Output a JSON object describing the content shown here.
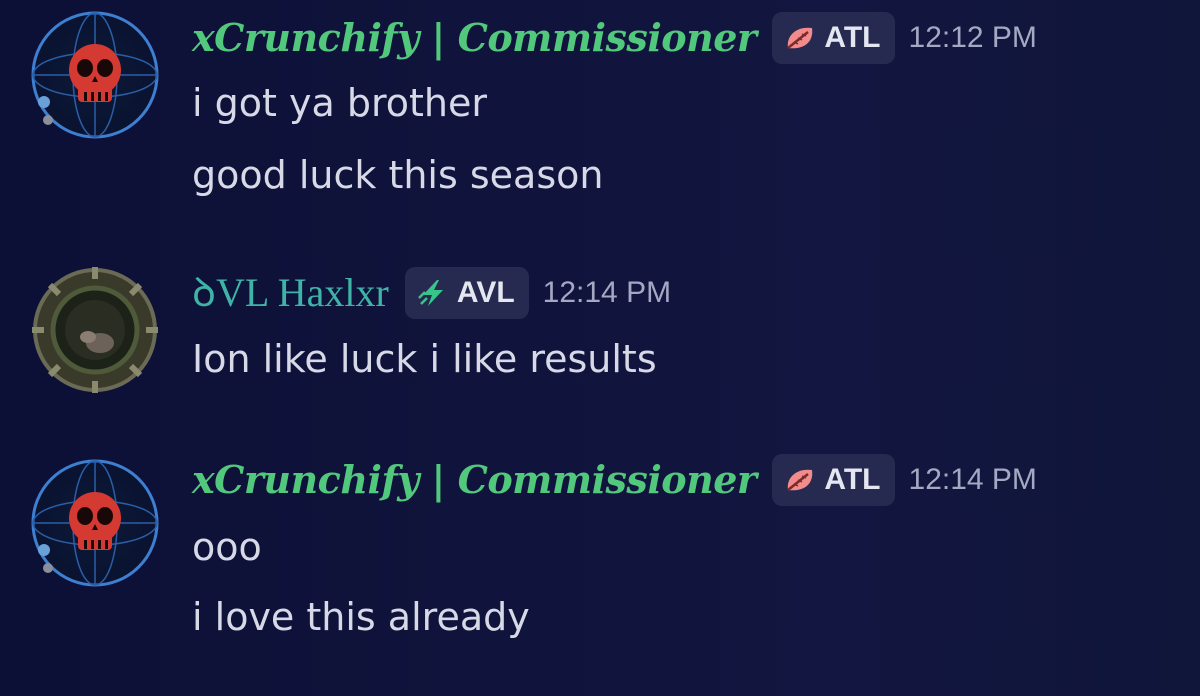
{
  "messages": [
    {
      "username": "xCrunchify | Commissioner",
      "tag": {
        "label": "ATL",
        "icon": "leaf-icon",
        "color": "#f28b8b"
      },
      "time": "12:12 PM",
      "lines": [
        "i got ya brother",
        "good luck this season"
      ]
    },
    {
      "username": "ꝺVL Haxlxr",
      "tag": {
        "label": "AVL",
        "icon": "lightning-icon",
        "color": "#37c58a"
      },
      "time": "12:14 PM",
      "lines": [
        "Ion like luck i like results"
      ]
    },
    {
      "username": "xCrunchify | Commissioner",
      "tag": {
        "label": "ATL",
        "icon": "leaf-icon",
        "color": "#f28b8b"
      },
      "time": "12:14 PM",
      "lines": [
        "ooo",
        "i love this already"
      ]
    }
  ],
  "colors": {
    "crunchify_name": "#52c87d",
    "haxlxr_name": "#3fb3a7",
    "message_text": "#d7d9e6",
    "timestamp": "#a4a8c2",
    "tag_bg": "#262a50"
  }
}
